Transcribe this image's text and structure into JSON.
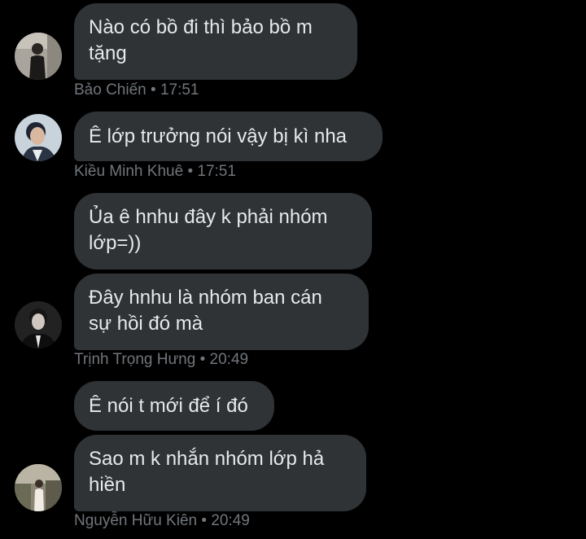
{
  "messages": [
    {
      "sender": "Bảo Chiến",
      "time": "17:51",
      "avatar_icon": "user-avatar-photo",
      "bubbles": [
        "Nào có bồ đi thì bảo bồ m\ntặng"
      ]
    },
    {
      "sender": "Kiều Minh Khuê",
      "time": "17:51",
      "avatar_icon": "user-avatar-photo",
      "bubbles": [
        "Ê lớp trưởng nói vậy bị kì nha"
      ]
    },
    {
      "sender": "Trịnh Trọng Hưng",
      "time": "20:49",
      "avatar_icon": "user-avatar-photo",
      "bubbles": [
        "Ủa ê hnhu đây k phải nhóm\nlớp=))",
        "Đây hnhu là nhóm ban cán\nsự hồi đó mà"
      ]
    },
    {
      "sender": "Nguyễn Hữu Kiên",
      "time": "20:49",
      "avatar_icon": "user-avatar-photo",
      "bubbles": [
        "Ê nói t mới để í đó",
        "Sao m k nhắn nhóm lớp hả\nhiền"
      ]
    }
  ],
  "separator": "•",
  "colors": {
    "background": "#000000",
    "bubble": "#2f3336",
    "text": "#e7e9ea",
    "meta": "#71767b"
  }
}
